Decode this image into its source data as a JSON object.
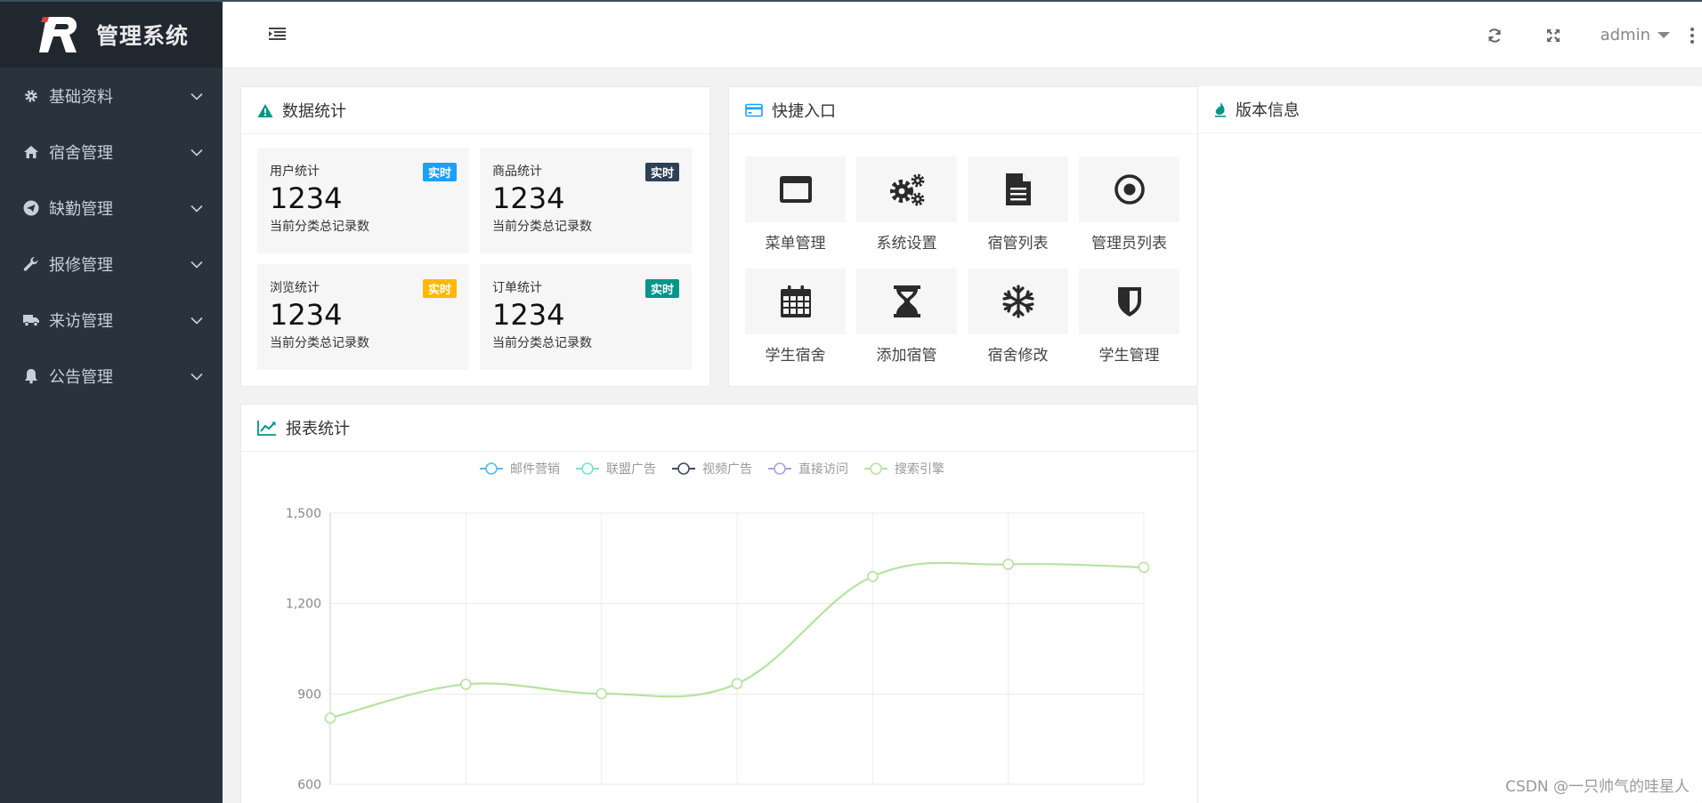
{
  "sidebar": {
    "title": "管理系统",
    "items": [
      {
        "label": "基础资料",
        "icon": "gear-icon"
      },
      {
        "label": "宿舍管理",
        "icon": "home-icon"
      },
      {
        "label": "缺勤管理",
        "icon": "paper-plane-icon"
      },
      {
        "label": "报修管理",
        "icon": "wrench-icon"
      },
      {
        "label": "来访管理",
        "icon": "truck-icon"
      },
      {
        "label": "公告管理",
        "icon": "bell-icon"
      }
    ]
  },
  "header": {
    "user": "admin",
    "icons": [
      "hamburger-icon",
      "refresh-icon",
      "fullscreen-icon",
      "more-vertical-icon"
    ]
  },
  "stats_card": {
    "title": "数据统计",
    "items": [
      {
        "label": "用户统计",
        "badge": "实时",
        "badge_color": "#1e9fff",
        "value": "1234",
        "desc": "当前分类总记录数"
      },
      {
        "label": "商品统计",
        "badge": "实时",
        "badge_color": "#2f4056",
        "value": "1234",
        "desc": "当前分类总记录数"
      },
      {
        "label": "浏览统计",
        "badge": "实时",
        "badge_color": "#ffb800",
        "value": "1234",
        "desc": "当前分类总记录数"
      },
      {
        "label": "订单统计",
        "badge": "实时",
        "badge_color": "#009688",
        "value": "1234",
        "desc": "当前分类总记录数"
      }
    ]
  },
  "quick_card": {
    "title": "快捷入口",
    "items": [
      {
        "label": "菜单管理",
        "icon": "window-icon"
      },
      {
        "label": "系统设置",
        "icon": "gears-icon"
      },
      {
        "label": "宿管列表",
        "icon": "file-text-icon"
      },
      {
        "label": "管理员列表",
        "icon": "dot-circle-icon"
      },
      {
        "label": "学生宿舍",
        "icon": "calendar-icon"
      },
      {
        "label": "添加宿管",
        "icon": "hourglass-icon"
      },
      {
        "label": "宿舍修改",
        "icon": "snowflake-icon"
      },
      {
        "label": "学生管理",
        "icon": "shield-icon"
      }
    ]
  },
  "version_card": {
    "title": "版本信息"
  },
  "report_card": {
    "title": "报表统计"
  },
  "chart_data": {
    "type": "line",
    "legend": [
      {
        "name": "邮件营销",
        "color": "#5bb7f0"
      },
      {
        "name": "联盟广告",
        "color": "#7fe1c8"
      },
      {
        "name": "视频广告",
        "color": "#3d4a6b"
      },
      {
        "name": "直接访问",
        "color": "#a7a3e6"
      },
      {
        "name": "搜索引擎",
        "color": "#b5e3a0"
      }
    ],
    "series": [
      {
        "name": "搜索引擎",
        "values": [
          820,
          932,
          901,
          934,
          1290,
          1330,
          1320
        ]
      }
    ],
    "y_ticks": [
      "1,500",
      "1,200",
      "900",
      "600"
    ],
    "ylim": [
      600,
      1500
    ],
    "grid": true,
    "legend_position": "top-center"
  },
  "watermark": "CSDN @一只帅气的哇星人"
}
